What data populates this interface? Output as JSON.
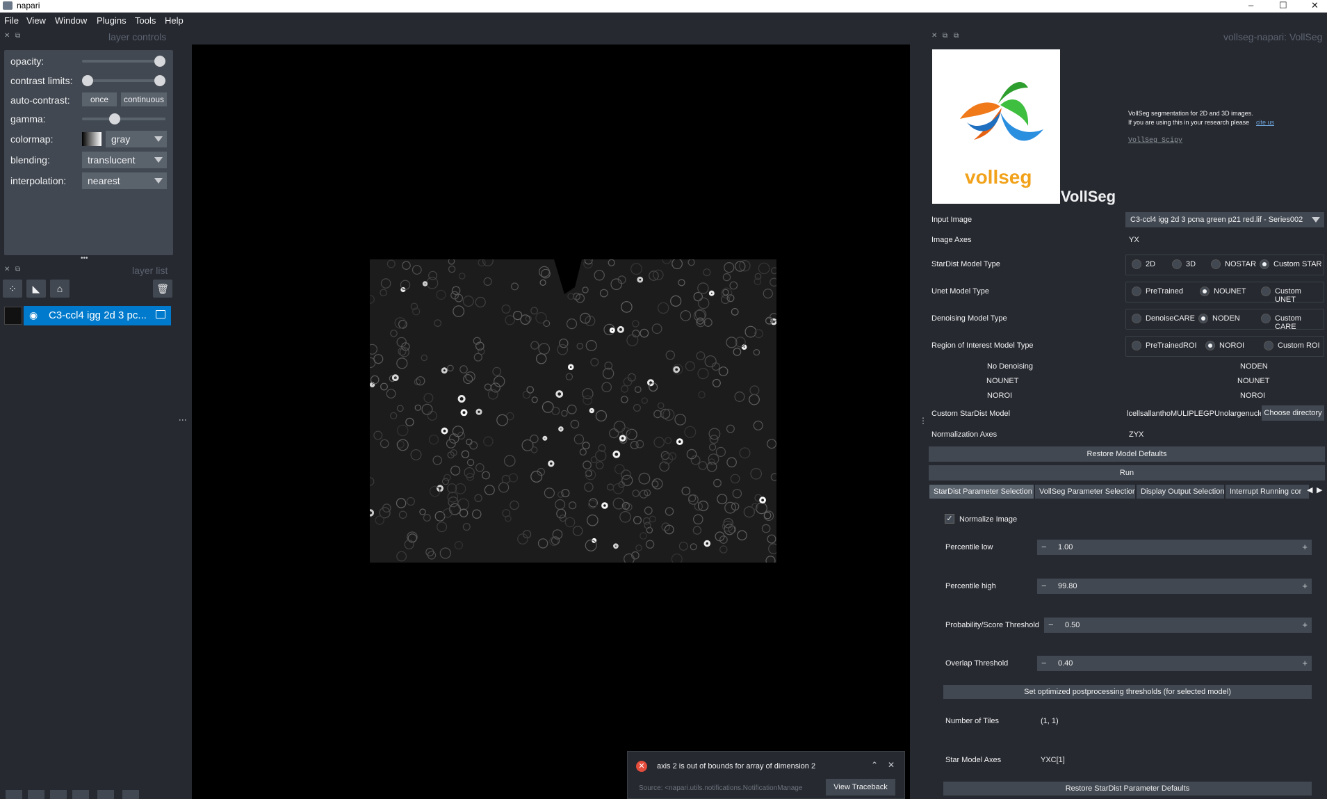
{
  "window": {
    "title": "napari",
    "controls": [
      "–",
      "☐",
      "✕"
    ]
  },
  "menu": [
    "File",
    "View",
    "Window",
    "Plugins",
    "Tools",
    "Help"
  ],
  "layer_controls": {
    "title": "layer controls",
    "opacity_label": "opacity:",
    "opacity_value": 1.0,
    "contrast_label": "contrast limits:",
    "autocontrast_label": "auto-contrast:",
    "once_label": "once",
    "continuous_label": "continuous",
    "gamma_label": "gamma:",
    "gamma_value": 0.5,
    "colormap_label": "colormap:",
    "colormap_value": "gray",
    "blending_label": "blending:",
    "blending_value": "translucent",
    "interpolation_label": "interpolation:",
    "interpolation_value": "nearest"
  },
  "layer_list": {
    "title": "layer list",
    "dots": "•••",
    "layers": [
      {
        "name": "C3-ccl4 igg 2d 3 pc...",
        "selected": true
      }
    ]
  },
  "notification": {
    "message": "axis 2 is out of bounds for array of dimension 2",
    "source": "Source: <napari.utils.notifications.NotificationManage",
    "traceback_label": "View Traceback",
    "icon": "error-icon"
  },
  "plugin": {
    "dock_title": "vollseg-napari: VollSeg",
    "logo_text": "vollseg",
    "heading": "VollSeg",
    "info_line1": "VollSeg segmentation for 2D and 3D images.",
    "info_line2": "If you are using this in your research please",
    "cite_link": "cite us",
    "scipy_link": "VollSeg Scipy",
    "input_image_label": "Input Image",
    "input_image_value": "C3-ccl4 igg 2d 3 pcna green p21 red.lif - Series002",
    "image_axes_label": "Image Axes",
    "image_axes_value": "YX",
    "stardist_type_label": "StarDist Model Type",
    "stardist_options": [
      "2D",
      "3D",
      "NOSTAR",
      "Custom STAR"
    ],
    "unet_type_label": "Unet Model Type",
    "unet_options": [
      "PreTrained",
      "NOUNET",
      "Custom UNET"
    ],
    "denoise_type_label": "Denoising Model Type",
    "denoise_options": [
      "DenoiseCARE",
      "NODEN",
      "Custom CARE"
    ],
    "roi_type_label": "Region of Interest Model Type",
    "roi_options": [
      "PreTrainedROI",
      "NOROI",
      "Custom ROI"
    ],
    "summary_left": [
      "No Denoising",
      "NOUNET",
      "NOROI"
    ],
    "summary_right": [
      "NODEN",
      "NOUNET",
      "NOROI"
    ],
    "custom_stardist_label": "Custom StarDist Model",
    "custom_stardist_value": "lcellsallanthoMULIPLEGPUnolargenuclei",
    "choose_dir_label": "Choose directory",
    "norm_axes_label": "Normalization Axes",
    "norm_axes_value": "ZYX",
    "restore_model_label": "Restore Model Defaults",
    "run_label": "Run",
    "tabs": [
      "StarDist Parameter Selection",
      "VollSeg Parameter Selection",
      "Display Output Selection",
      "Interrupt Running cor"
    ],
    "normalize_label": "Normalize Image",
    "normalize_checked": "✓",
    "percentile_low_label": "Percentile low",
    "percentile_low_value": "1.00",
    "percentile_high_label": "Percentile high",
    "percentile_high_value": "99.80",
    "prob_label": "Probability/Score Threshold",
    "prob_value": "0.50",
    "overlap_label": "Overlap Threshold",
    "overlap_value": "0.40",
    "set_optimized_label": "Set optimized postprocessing thresholds (for selected model)",
    "tiles_label": "Number of Tiles",
    "tiles_value": "(1, 1)",
    "star_axes_label": "Star Model Axes",
    "star_axes_value": "YXC[1]",
    "restore_stardist_label": "Restore StarDist Parameter Defaults"
  }
}
